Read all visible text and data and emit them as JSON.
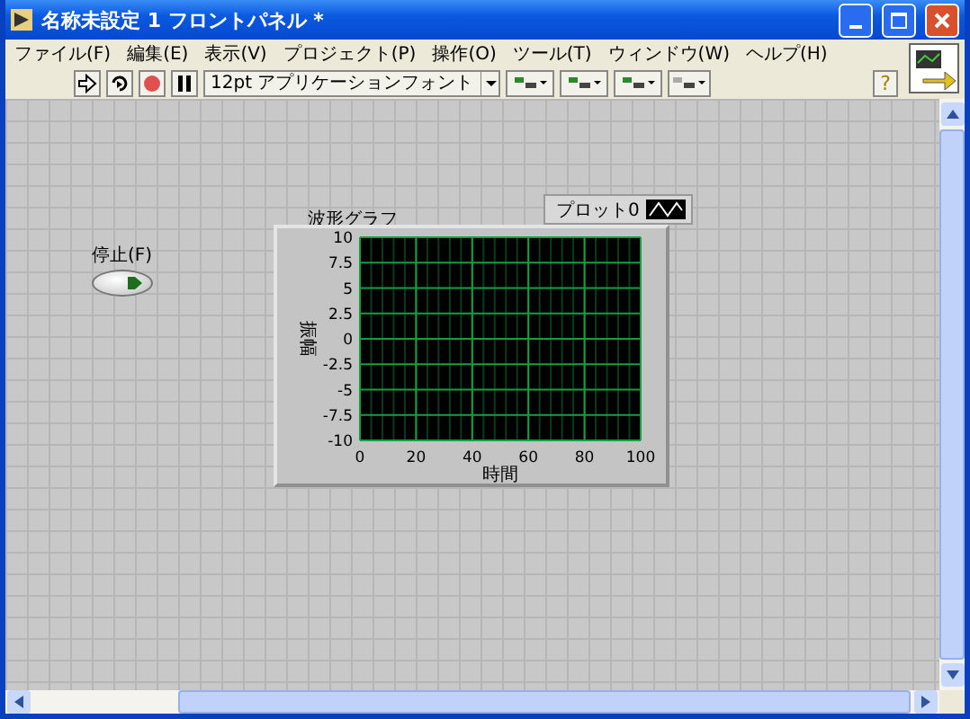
{
  "window": {
    "title": "名称未設定 1 フロントパネル *"
  },
  "menu": [
    "ファイル(F)",
    "編集(E)",
    "表示(V)",
    "プロジェクト(P)",
    "操作(O)",
    "ツール(T)",
    "ウィンドウ(W)",
    "ヘルプ(H)"
  ],
  "toolbar": {
    "font_select": "12pt アプリケーションフォント",
    "help": "?"
  },
  "controls": [
    {
      "kind": "stop_button",
      "label": "停止(F)"
    }
  ],
  "graph": {
    "label": "波形グラフ",
    "legend": "プロット0",
    "chart_data": {
      "type": "line",
      "grid": true,
      "xlabel": "時間",
      "ylabel": "振幅",
      "xlim": [
        0,
        100
      ],
      "ylim": [
        -10,
        10
      ],
      "xticks": [
        0,
        20,
        40,
        60,
        80,
        100
      ],
      "yticks": [
        10,
        7.5,
        5,
        2.5,
        0,
        -2.5,
        -5,
        -7.5,
        -10
      ]
    }
  }
}
